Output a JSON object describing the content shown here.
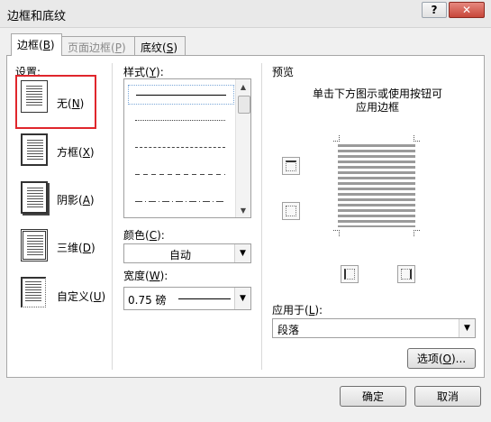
{
  "window": {
    "title": "边框和底纹",
    "help_glyph": "?",
    "close_glyph": "✕"
  },
  "tabs": [
    {
      "prefix": "边框(",
      "key": "B",
      "suffix": ")"
    },
    {
      "prefix": "页面边框(",
      "key": "P",
      "suffix": ")"
    },
    {
      "prefix": "底纹(",
      "key": "S",
      "suffix": ")"
    }
  ],
  "settings": {
    "label": "设置:",
    "items": [
      {
        "prefix": "无(",
        "key": "N",
        "suffix": ")"
      },
      {
        "prefix": "方框(",
        "key": "X",
        "suffix": ")"
      },
      {
        "prefix": "阴影(",
        "key": "A",
        "suffix": ")"
      },
      {
        "prefix": "三维(",
        "key": "D",
        "suffix": ")"
      },
      {
        "prefix": "自定义(",
        "key": "U",
        "suffix": ")"
      }
    ]
  },
  "style": {
    "prefix": "样式(",
    "key": "Y",
    "suffix": "):"
  },
  "color": {
    "prefix": "颜色(",
    "key": "C",
    "suffix": "):",
    "value": "自动"
  },
  "width": {
    "prefix": "宽度(",
    "key": "W",
    "suffix": "):",
    "value": "0.75 磅"
  },
  "preview": {
    "label": "预览",
    "hint_line1": "单击下方图示或使用按钮可",
    "hint_line2": "应用边框"
  },
  "apply_to": {
    "prefix": "应用于(",
    "key": "L",
    "suffix": "):",
    "value": "段落"
  },
  "options_button": {
    "prefix": "选项(",
    "key": "O",
    "suffix": ")..."
  },
  "ok_button": "确定",
  "cancel_button": "取消",
  "colors": {
    "highlight": "#e0262c",
    "tab_border": "#a7a7a7"
  }
}
